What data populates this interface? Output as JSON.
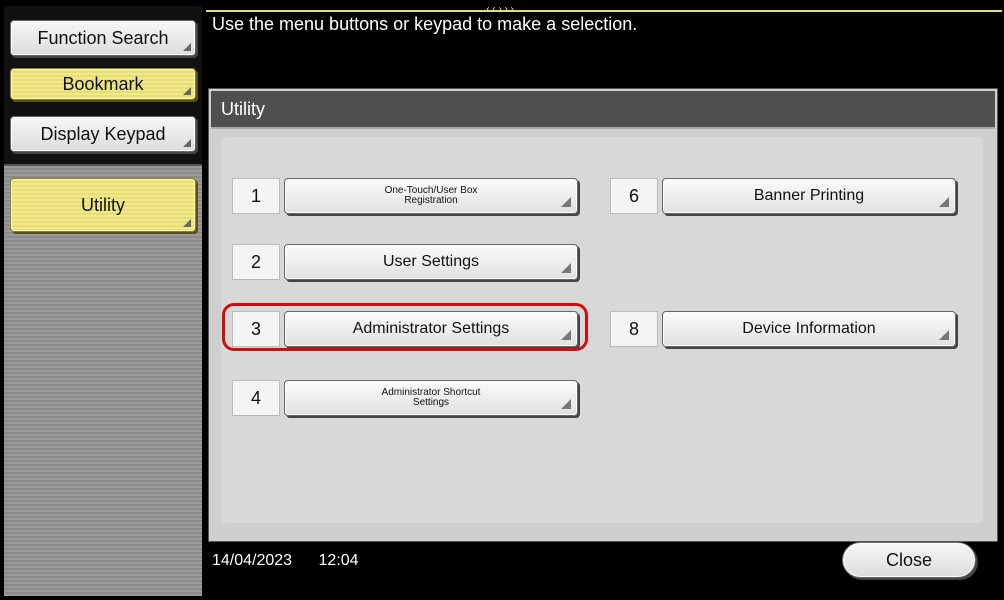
{
  "header": {
    "message": "Use the menu buttons or keypad to make a selection.",
    "handle_glyph": "‹‹›››"
  },
  "sidebar": {
    "function_search": "Function Search",
    "bookmark": "Bookmark",
    "display_keypad": "Display Keypad",
    "utility": "Utility"
  },
  "panel": {
    "title": "Utility",
    "items": [
      {
        "num": "1",
        "label": "One-Touch/User Box\nRegistration"
      },
      {
        "num": "2",
        "label": "User Settings"
      },
      {
        "num": "3",
        "label": "Administrator Settings"
      },
      {
        "num": "4",
        "label": "Administrator Shortcut\nSettings"
      },
      {
        "num": "6",
        "label": "Banner Printing"
      },
      {
        "num": "8",
        "label": "Device Information"
      }
    ]
  },
  "footer": {
    "date": "14/04/2023",
    "time": "12:04",
    "close": "Close"
  },
  "colors": {
    "highlight": "#d10d0d",
    "selected_yellow": "#e6dd74"
  }
}
